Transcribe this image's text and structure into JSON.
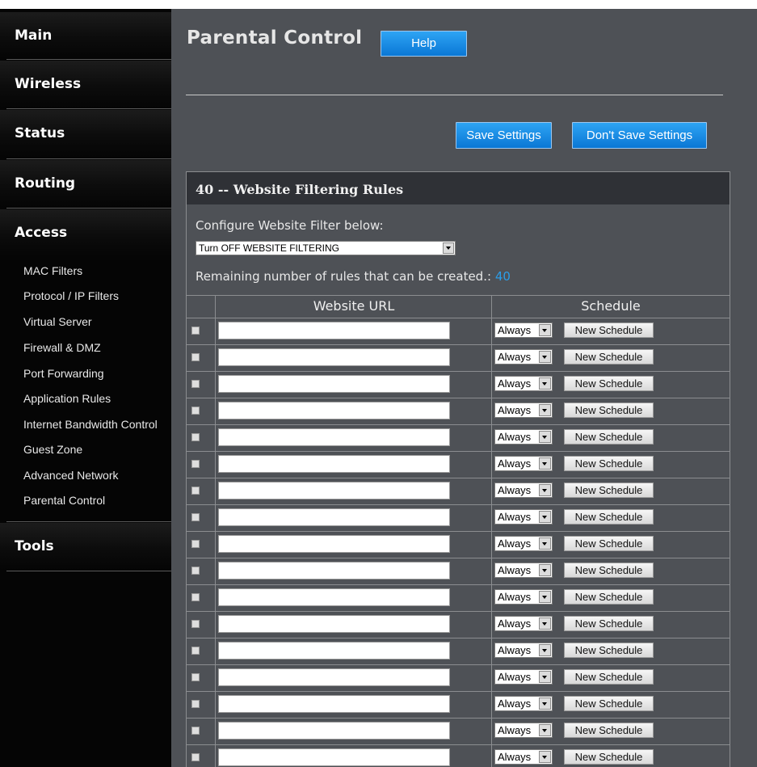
{
  "sidebar": {
    "sections": [
      "Main",
      "Wireless",
      "Status",
      "Routing",
      "Access",
      "Tools"
    ],
    "access_items": [
      "MAC Filters",
      "Protocol / IP Filters",
      "Virtual Server",
      "Firewall & DMZ",
      "Port Forwarding",
      "Application Rules",
      "Internet Bandwidth Control",
      "Guest Zone",
      "Advanced Network",
      "Parental Control"
    ],
    "active_section": "Access",
    "active_item": "Parental Control"
  },
  "header": {
    "title": "Parental Control",
    "help_label": "Help"
  },
  "toolbar": {
    "save_label": "Save Settings",
    "dont_save_label": "Don't Save Settings"
  },
  "panel": {
    "title": "40 -- Website Filtering Rules",
    "configure_label": "Configure Website Filter below:",
    "filter_value": "Turn OFF WEBSITE FILTERING",
    "remaining_label": "Remaining number of rules that can be created.:",
    "remaining_count": "40",
    "col_url": "Website URL",
    "col_schedule": "Schedule",
    "row_schedule_value": "Always",
    "row_button_label": "New Schedule",
    "visible_rows": 17
  },
  "colors": {
    "accent_blue": "#1a8ee6",
    "sidebar_bg": "#050505",
    "content_bg": "#4e5156",
    "panel_header_bg": "#2f3136",
    "count_color": "#2b9de8"
  }
}
